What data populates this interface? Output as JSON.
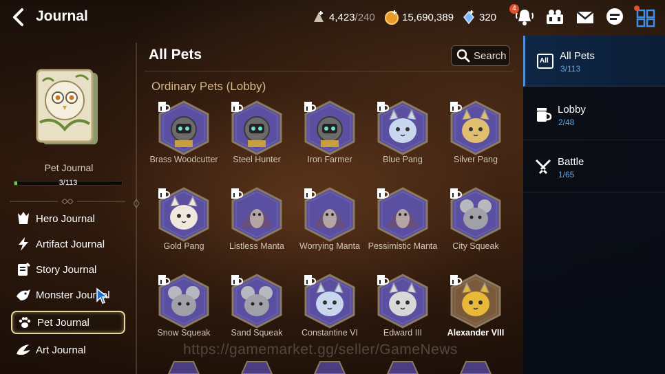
{
  "header": {
    "title": "Journal",
    "stamina": "4,423",
    "stamina_max": "/240",
    "gold": "15,690,389",
    "crystals": "320",
    "notification_count": "4"
  },
  "sidebar": {
    "book_label": "Pet Journal",
    "progress_text": "3/113",
    "progress_fraction": 0.027,
    "items": [
      {
        "label": "Hero Journal",
        "icon": "hero-icon"
      },
      {
        "label": "Artifact Journal",
        "icon": "artifact-icon"
      },
      {
        "label": "Story Journal",
        "icon": "story-icon"
      },
      {
        "label": "Monster Journal",
        "icon": "monster-icon"
      },
      {
        "label": "Pet Journal",
        "icon": "paw-icon",
        "active": true
      },
      {
        "label": "Art Journal",
        "icon": "art-icon"
      }
    ]
  },
  "main": {
    "title": "All Pets",
    "search_label": "Search",
    "section_label": "Ordinary Pets (Lobby)",
    "watermark": "https://gamemarket.gg/seller/GameNews",
    "pets": [
      {
        "name": "Brass Woodcutter",
        "kind": "robot",
        "color": "#5a4fa0"
      },
      {
        "name": "Steel Hunter",
        "kind": "robot",
        "color": "#5a4fa0"
      },
      {
        "name": "Iron Farmer",
        "kind": "robot",
        "color": "#5a4fa0"
      },
      {
        "name": "Blue Pang",
        "kind": "cat",
        "color": "#5a4fa0"
      },
      {
        "name": "Silver Pang",
        "kind": "cat",
        "color": "#5a4fa0"
      },
      {
        "name": "Gold Pang",
        "kind": "cat",
        "color": "#5a4fa0"
      },
      {
        "name": "Listless Manta",
        "kind": "manta",
        "color": "#5a4fa0"
      },
      {
        "name": "Worrying Manta",
        "kind": "manta",
        "color": "#5a4fa0"
      },
      {
        "name": "Pessimistic Manta",
        "kind": "manta",
        "color": "#5a4fa0"
      },
      {
        "name": "City Squeak",
        "kind": "mouse",
        "color": "#5a4fa0"
      },
      {
        "name": "Snow Squeak",
        "kind": "mouse",
        "color": "#5a4fa0"
      },
      {
        "name": "Sand Squeak",
        "kind": "mouse",
        "color": "#5a4fa0"
      },
      {
        "name": "Constantine VI",
        "kind": "cat",
        "color": "#5a4fa0"
      },
      {
        "name": "Edward III",
        "kind": "cat",
        "color": "#5a4fa0"
      },
      {
        "name": "Alexander VIII",
        "kind": "cat",
        "color": "#7a5a3a",
        "owned": true
      }
    ]
  },
  "categories": [
    {
      "name": "All Pets",
      "count": "3/113",
      "icon": "all-icon",
      "active": true
    },
    {
      "name": "Lobby",
      "count": "2/48",
      "icon": "lobby-icon"
    },
    {
      "name": "Battle",
      "count": "1/65",
      "icon": "battle-icon"
    }
  ],
  "colors": {
    "accent_blue": "#5ea8ea",
    "progress_green": "#6fd14e",
    "section_gold": "#d5b98a",
    "active_border": "#e8d89c"
  }
}
